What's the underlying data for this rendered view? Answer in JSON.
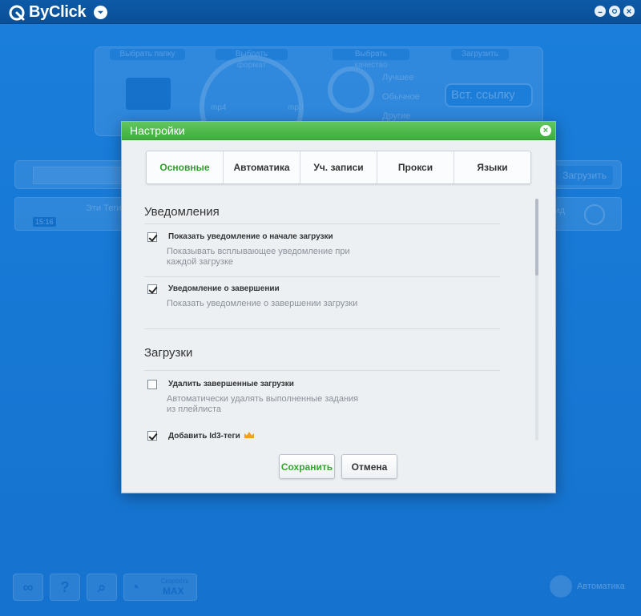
{
  "app": {
    "name": "ByClick",
    "top_panel": {
      "folder_label": "Выбрать папку",
      "format_label": "Выбрать формат",
      "quality_label": "Выбрать качество",
      "download_label": "Загрузить",
      "mp4_label": "mp4",
      "mp3_label": "mp3",
      "quality_options": [
        "Лучшее",
        "Обычное",
        "Другие"
      ],
      "paste_link_label": "Вст. ссылку"
    },
    "url_bar": {
      "download_button": "Загрузить"
    },
    "download_item": {
      "time": "15:16",
      "title": "Эти Теги",
      "status": "Ожид"
    },
    "bottom": {
      "speed_sub": "Скорость",
      "speed_value": "MAX",
      "auto_label": "Автоматика"
    }
  },
  "dialog": {
    "title": "Настройки",
    "tabs": [
      {
        "label": "Основные",
        "active": true
      },
      {
        "label": "Автоматика",
        "active": false
      },
      {
        "label": "Уч. записи",
        "active": false
      },
      {
        "label": "Прокси",
        "active": false
      },
      {
        "label": "Языки",
        "active": false
      }
    ],
    "sections": [
      {
        "title": "Уведомления",
        "options": [
          {
            "label": "Показать уведомление о начале загрузки",
            "desc": "Показывать всплывающее уведомление при каждой загрузке",
            "checked": true
          },
          {
            "label": "Уведомление о завершении",
            "desc": "Показать уведомление о завершении загрузки",
            "checked": true
          }
        ]
      },
      {
        "title": "Загрузки",
        "options": [
          {
            "label": "Удалить завершенные загрузки",
            "desc": "Автоматически удалять выполненные задания из плейлиста",
            "checked": false
          },
          {
            "label": "Добавить Id3-теги",
            "desc": "",
            "checked": true,
            "premium": true
          }
        ]
      }
    ],
    "buttons": {
      "save": "Сохранить",
      "cancel": "Отмена"
    }
  },
  "colors": {
    "accent_green": "#3fae3c",
    "app_blue": "#1a7fd8",
    "crown": "#f0a020"
  }
}
